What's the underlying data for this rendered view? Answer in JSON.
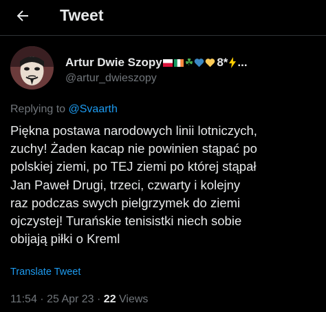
{
  "header": {
    "title": "Tweet",
    "back_icon": "arrow-left-icon"
  },
  "author": {
    "display_name": "Artur Dwie Szopy",
    "name_emojis": [
      "🇵🇱",
      "🇮🇪",
      "☘",
      "💙",
      "💛",
      "8*",
      "⚡",
      "..."
    ],
    "username": "@artur_dwieszopy",
    "avatar": "masked-face-avatar"
  },
  "reply": {
    "prefix": "Replying to",
    "handle": "@Svaarth"
  },
  "tweet": {
    "lines": [
      "Piękna postawa narodowych linii lotniczych,",
      "zuchy! Żaden kacap nie powinien stąpać po",
      "polskiej ziemi, po TEJ ziemi po której stąpał",
      "Jan Paweł Drugi, trzeci, czwarty i kolejny",
      "raz podczas swych pielgrzymek do ziemi",
      "ojczystej! Turańskie tenisistki niech sobie",
      "obijają piłki o Kreml"
    ],
    "translate_label": "Translate Tweet"
  },
  "meta": {
    "time": "11:54",
    "sep1": " · ",
    "date": "25 Apr 23",
    "sep2": " · ",
    "views_count": "22",
    "views_label": " Views"
  },
  "colors": {
    "background": "#000000",
    "text": "#e7e9ea",
    "secondary": "#71767b",
    "accent": "#1d9bf0"
  }
}
